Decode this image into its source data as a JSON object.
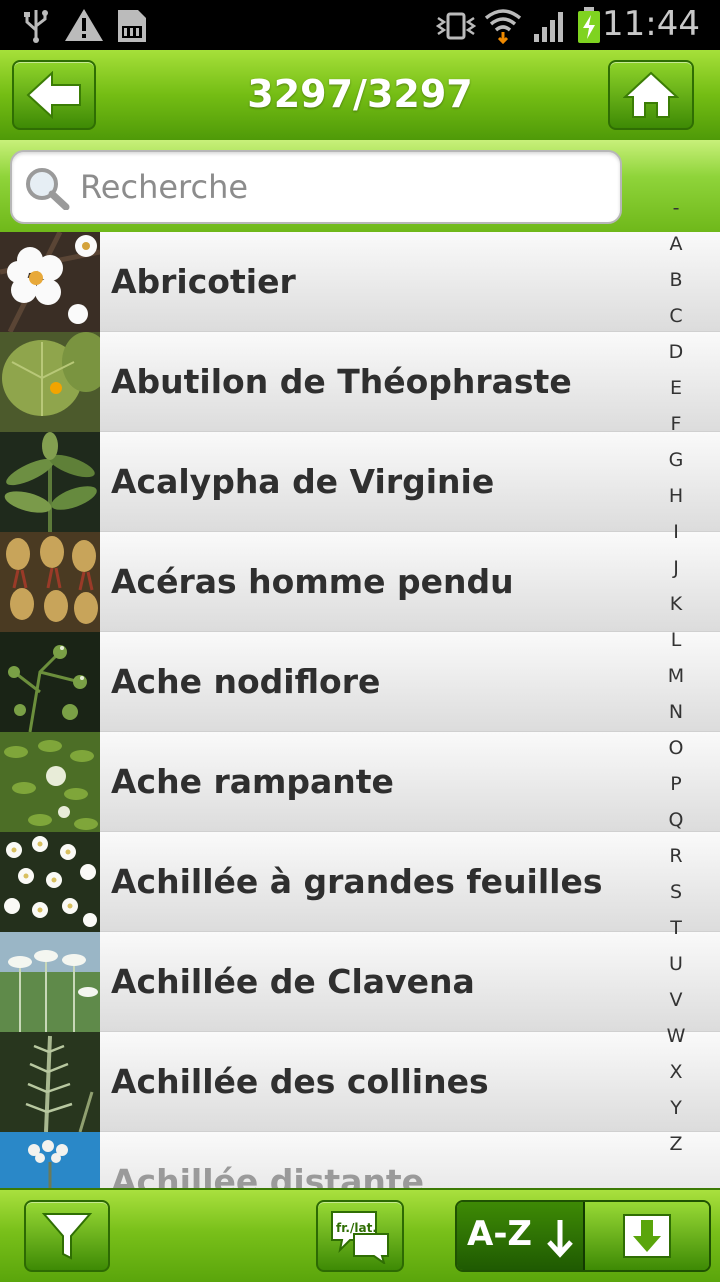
{
  "status_bar": {
    "time": "11:44",
    "icons": [
      "usb-icon",
      "warning-icon",
      "sd-card-icon",
      "vibrate-icon",
      "wifi-icon",
      "signal-icon",
      "battery-charging-icon"
    ]
  },
  "header": {
    "count": "3297/3297",
    "back_icon": "arrow-left-icon",
    "home_icon": "home-icon"
  },
  "search": {
    "placeholder": "Recherche",
    "value": ""
  },
  "plants": [
    {
      "name": "Abricotier",
      "thumb": "white-blossom"
    },
    {
      "name": "Abutilon de Théophraste",
      "thumb": "large-leaf"
    },
    {
      "name": "Acalypha de Virginie",
      "thumb": "leafy-stem"
    },
    {
      "name": "Acéras homme pendu",
      "thumb": "orchid"
    },
    {
      "name": "Ache nodiflore",
      "thumb": "umbel-small"
    },
    {
      "name": "Ache rampante",
      "thumb": "umbel-green"
    },
    {
      "name": "Achillée à grandes feuilles",
      "thumb": "white-flowers"
    },
    {
      "name": "Achillée de Clavena",
      "thumb": "meadow-flowers"
    },
    {
      "name": "Achillée des collines",
      "thumb": "fern-leaf"
    },
    {
      "name": "Achillée distante",
      "thumb": "sky-flower"
    }
  ],
  "alphabet": [
    "-",
    "A",
    "B",
    "C",
    "D",
    "E",
    "F",
    "G",
    "H",
    "I",
    "J",
    "K",
    "L",
    "M",
    "N",
    "O",
    "P",
    "Q",
    "R",
    "S",
    "T",
    "U",
    "V",
    "W",
    "X",
    "Y",
    "Z"
  ],
  "toolbar": {
    "filter_icon": "filter-funnel-icon",
    "language_label": "fr./lat.",
    "sort_label": "A-Z",
    "download_icon": "download-icon"
  },
  "colors": {
    "header_green": "#74bd14",
    "toolbar_green": "#79c01a",
    "dark_green": "#2f6e03",
    "row_text": "#2f2f2f"
  }
}
